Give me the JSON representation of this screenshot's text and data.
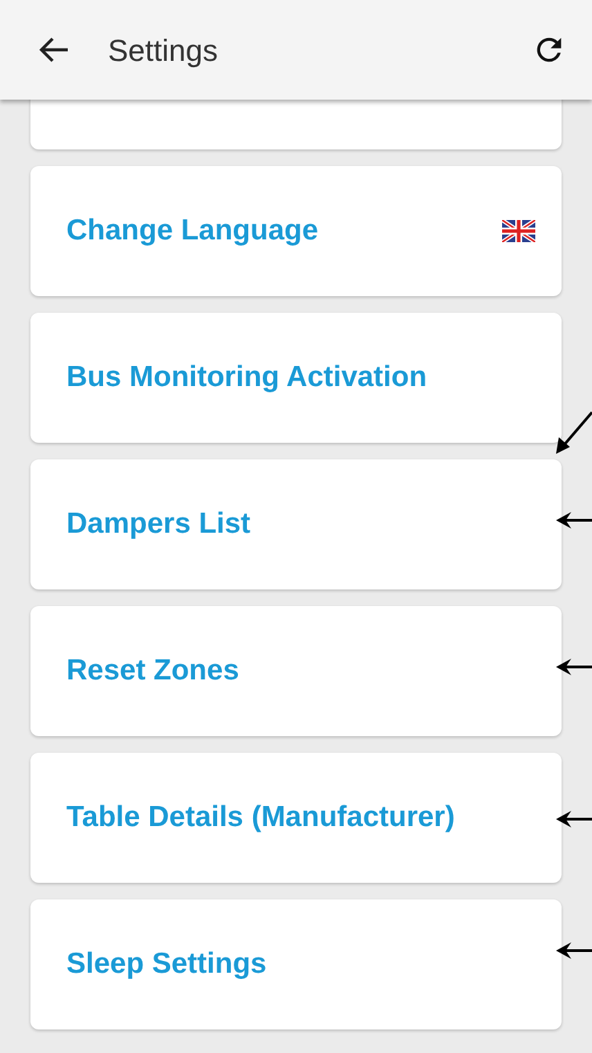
{
  "app_bar": {
    "title": "Settings"
  },
  "settings_items": [
    {
      "kind": "partial"
    },
    {
      "kind": "flag",
      "label": "Change Language"
    },
    {
      "kind": "plain",
      "label": "Bus Monitoring Activation"
    },
    {
      "kind": "plain",
      "label": "Dampers List"
    },
    {
      "kind": "plain",
      "label": "Reset Zones"
    },
    {
      "kind": "plain",
      "label": "Table Details (Manufacturer)"
    },
    {
      "kind": "plain",
      "label": "Sleep Settings"
    }
  ]
}
